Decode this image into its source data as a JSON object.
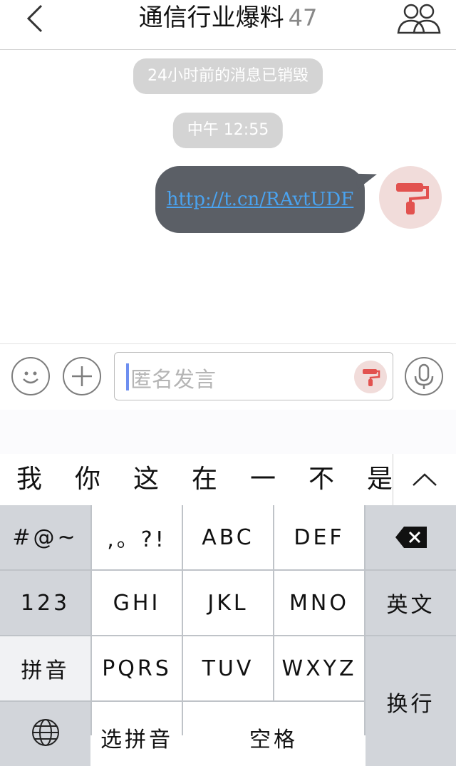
{
  "nav": {
    "title": "通信行业爆料",
    "member_count": "47"
  },
  "messages": {
    "system_notice": "24小时前的消息已销毁",
    "timestamp": "中午 12:55",
    "link_text": "http://t.cn/RAvtUDF"
  },
  "input": {
    "placeholder": "匿名发言"
  },
  "candidates": [
    "我",
    "你",
    "这",
    "在",
    "一",
    "不",
    "是"
  ],
  "keys": {
    "symbols": "#@~",
    "punct": ",。?!",
    "abc": "ABC",
    "def": "DEF",
    "num": "123",
    "ghi": "GHI",
    "jkl": "JKL",
    "mno": "MNO",
    "english": "英文",
    "pinyin": "拼音",
    "pqrs": "PQRS",
    "tuv": "TUV",
    "wxyz": "WXYZ",
    "enter": "换行",
    "select_pinyin": "选拼音",
    "space": "空格"
  },
  "colors": {
    "bubble": "#5b5f66",
    "link": "#4aa3f0",
    "avatar_bg": "#f1dcda",
    "avatar_icon": "#e2524f"
  }
}
